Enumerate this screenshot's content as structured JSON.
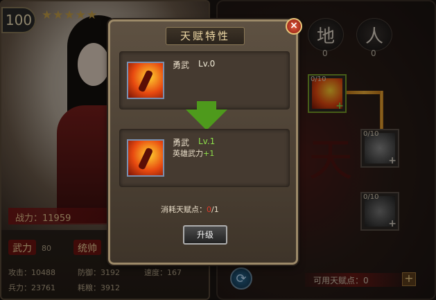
{
  "hero": {
    "level": "100",
    "stars": "★★★★★",
    "power_label": "战力：",
    "power_value": "11959",
    "attr_force_label": "武力",
    "attr_force_value": "80",
    "attr_command_label": "统帅",
    "attack": "攻击：10488",
    "defense": "防御：3192",
    "speed": "速度：167",
    "troops": "兵力：23761",
    "food": "耗粮：3912"
  },
  "tree": {
    "tab_earth": "地",
    "tab_earth_count": "0",
    "tab_human": "人",
    "tab_human_count": "0",
    "big_char": "天",
    "slot1_count": "0/10",
    "slot2_count": "0/10",
    "slot3_count": "0/10",
    "available_points": "可用天赋点：0",
    "plus": "+"
  },
  "modal": {
    "title": "天赋特性",
    "close": "×",
    "current_name": "勇武",
    "current_level": "Lv.0",
    "next_name": "勇武",
    "next_level": "Lv.1",
    "next_bonus_label": "英雄武力",
    "next_bonus_value": "+1",
    "cost_label": "消耗天赋点：",
    "cost_have": "0",
    "cost_need": "/1",
    "upgrade": "升级"
  },
  "colors": {
    "level_green": "#8ee04a",
    "cost_red": "#e23a2a",
    "level_white": "#f2ecd8"
  }
}
